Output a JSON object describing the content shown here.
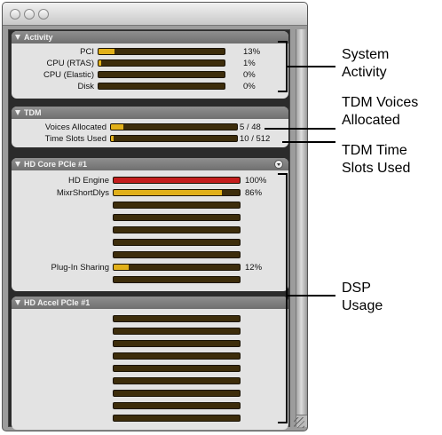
{
  "activity": {
    "title": "Activity",
    "rows": [
      {
        "label": "PCI",
        "value": "13%",
        "level": 0.13
      },
      {
        "label": "CPU (RTAS)",
        "value": "1%",
        "level": 0.01
      },
      {
        "label": "CPU (Elastic)",
        "value": "0%",
        "level": 0
      },
      {
        "label": "Disk",
        "value": "0%",
        "level": 0
      }
    ]
  },
  "tdm": {
    "title": "TDM",
    "rows": [
      {
        "label": "Voices Allocated",
        "value": "5 / 48",
        "level": 0.1
      },
      {
        "label": "Time Slots Used",
        "value": "10 / 512",
        "level": 0.02
      }
    ]
  },
  "core": {
    "title": "HD Core PCIe #1",
    "rows": [
      {
        "label": "HD Engine",
        "value": "100%",
        "level": 1.0,
        "color": "#c41d1d"
      },
      {
        "label": "MixrShortDlys",
        "value": "86%",
        "level": 0.86,
        "color": "#e1b01a"
      },
      {
        "label": "",
        "value": "",
        "level": 0
      },
      {
        "label": "",
        "value": "",
        "level": 0
      },
      {
        "label": "",
        "value": "",
        "level": 0
      },
      {
        "label": "",
        "value": "",
        "level": 0
      },
      {
        "label": "",
        "value": "",
        "level": 0
      },
      {
        "label": "Plug-In Sharing",
        "value": "12%",
        "level": 0.12
      },
      {
        "label": "",
        "value": "",
        "level": 0
      }
    ]
  },
  "accel": {
    "title": "HD Accel PCIe #1",
    "rows": [
      {
        "level": 0
      },
      {
        "level": 0
      },
      {
        "level": 0
      },
      {
        "level": 0
      },
      {
        "level": 0
      },
      {
        "level": 0
      },
      {
        "level": 0
      },
      {
        "level": 0
      },
      {
        "level": 0
      }
    ]
  },
  "colors": {
    "meter_fill": "#e1b01a",
    "meter_empty": "#3d2d0b"
  },
  "callouts": {
    "system_activity": "System\nActivity",
    "tdm_voices": "TDM Voices\nAllocated",
    "tdm_slots": "TDM Time\nSlots Used",
    "dsp_usage": "DSP\nUsage"
  }
}
